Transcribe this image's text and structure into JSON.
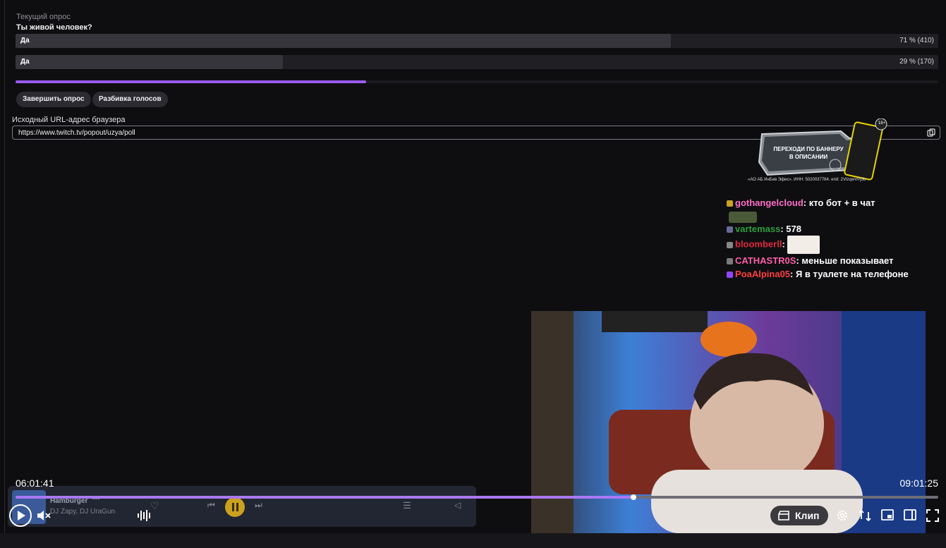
{
  "poll": {
    "label": "Текущий опрос",
    "question": "Ты живой человек?",
    "options": [
      {
        "label": "Да",
        "result": "71 % (410)",
        "percent": 71
      },
      {
        "label": "Да",
        "result": "29 % (170)",
        "percent": 29
      }
    ],
    "timer_progress": 0.38,
    "end_button": "Завершить опрос",
    "breakdown_button": "Разбивка голосов"
  },
  "source": {
    "label": "Исходный URL-адрес браузера",
    "url": "https://www.twitch.tv/popout/uzya/poll"
  },
  "banner": {
    "text_line1": "ПЕРЕХОДИ ПО БАННЕРУ",
    "text_line2": "В ОПИСАНИИ",
    "age_badge": "18+",
    "legal": "«АО АБ ИнБев Эфес». ИНН: 5020037784. erid: 2VtzqwVPj3b"
  },
  "chat": [
    {
      "user": "gothangelcloud",
      "color": "#ff6ec7",
      "text": ": кто бот + в чат"
    },
    {
      "user": "vartemass",
      "color": "#2e9e3e",
      "text": ": 578"
    },
    {
      "user": "bloomberll",
      "color": "#e0283c",
      "text": ":"
    },
    {
      "user": "CATHASTR0S",
      "color": "#ff5fa8",
      "text": ": меньше показывает"
    },
    {
      "user": "PoaAlpina05",
      "color": "#ff3d3d",
      "text": ": Я в туалете на телефоне"
    }
  ],
  "player": {
    "current_time": "06:01:41",
    "total_time": "09:01:25",
    "progress": 0.67,
    "clip_label": "Клип"
  },
  "music": {
    "track": "Hamburger",
    "artist": "DJ Zapy, DJ UraGun"
  },
  "colors": {
    "accent": "#9a5cf5",
    "background": "#0e0e11"
  }
}
